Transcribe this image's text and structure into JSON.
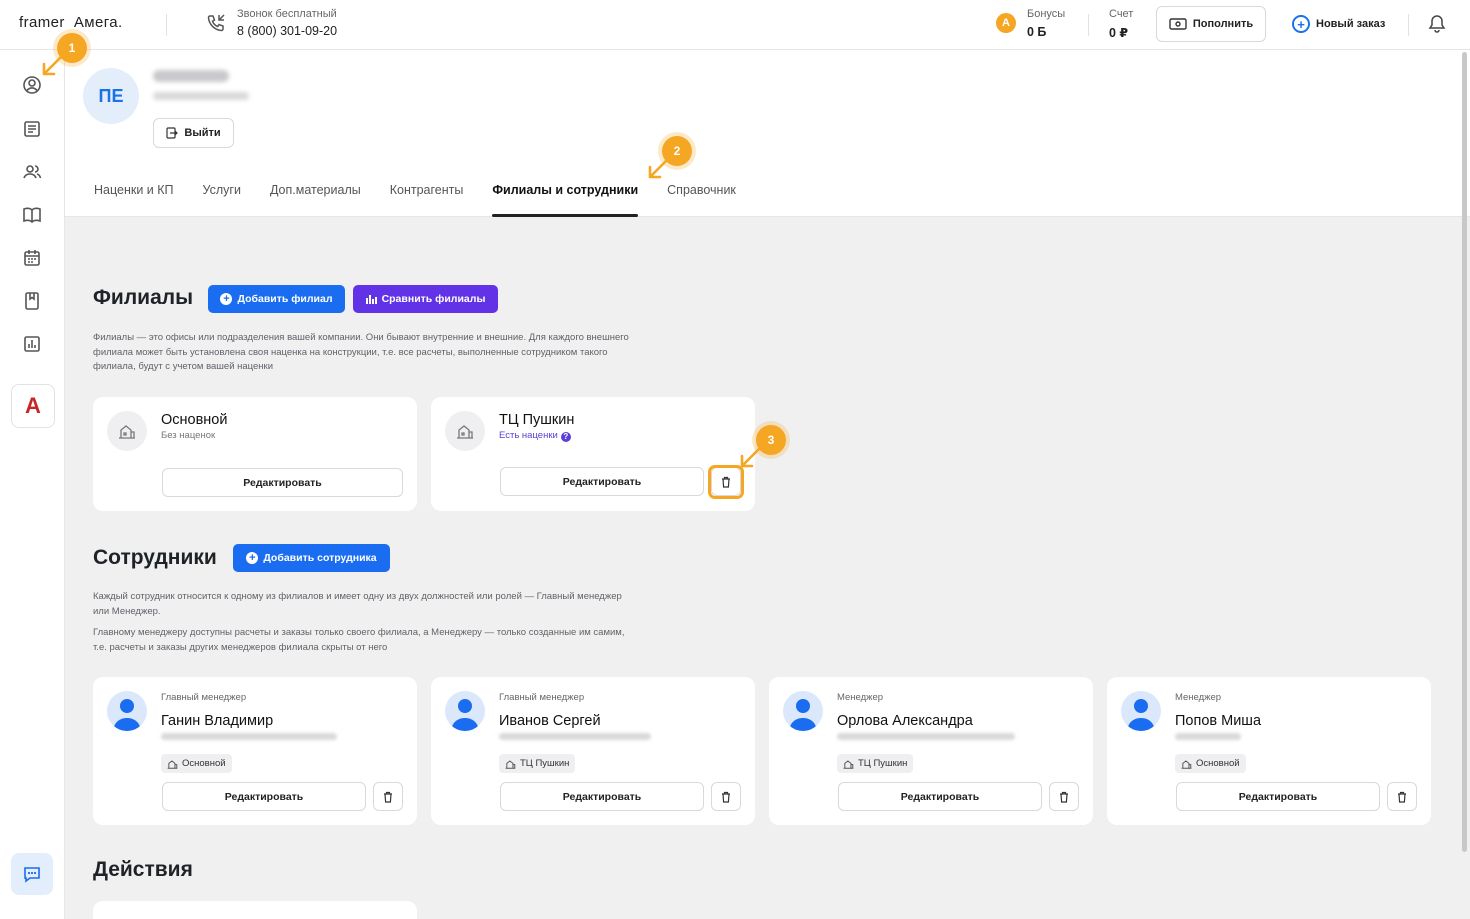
{
  "topbar": {
    "logo_left": "framer",
    "logo_right": "Амега.",
    "phone_caption": "Звонок бесплатный",
    "phone_number": "8 (800) 301-09-20",
    "bonus_caption": "Бонусы",
    "bonus_value": "0 Б",
    "account_caption": "Счет",
    "account_value": "0 ₽",
    "topup_label": "Пополнить",
    "new_order_label": "Новый заказ",
    "bonus_coin_letter": "A"
  },
  "sidebar": {
    "icons": [
      "profile-icon",
      "orders-icon",
      "users-icon",
      "catalog-book-icon",
      "calendar-icon",
      "bookmark-icon",
      "report-chart-icon"
    ],
    "brand_letter": "A",
    "chat_icon": "chat-icon"
  },
  "profile": {
    "avatar_initials": "ПЕ",
    "logout_label": "Выйти"
  },
  "tabs": [
    {
      "label": "Наценки и КП",
      "active": false
    },
    {
      "label": "Услуги",
      "active": false
    },
    {
      "label": "Доп.материалы",
      "active": false
    },
    {
      "label": "Контрагенты",
      "active": false
    },
    {
      "label": "Филиалы и сотрудники",
      "active": true
    },
    {
      "label": "Справочник",
      "active": false
    }
  ],
  "branches": {
    "title": "Филиалы",
    "add_label": "Добавить филиал",
    "compare_label": "Сравнить филиалы",
    "description": "Филиалы — это офисы или подразделения вашей компании. Они бывают внутренние и внешние. Для каждого внешнего филиала может быть установлена своя наценка на конструкции, т.е. все расчеты, выполненные сотрудником такого филиала, будут с учетом вашей наценки",
    "items": [
      {
        "name": "Основной",
        "subtitle": "Без наценок",
        "edit_label": "Редактировать"
      },
      {
        "name": "ТЦ Пушкин",
        "subtitle": "Есть наценки",
        "edit_label": "Редактировать"
      }
    ]
  },
  "employees": {
    "title": "Сотрудники",
    "add_label": "Добавить сотрудника",
    "description_1": "Каждый сотрудник относится к одному из филиалов и имеет одну из двух должностей или ролей — Главный менеджер или Менеджер.",
    "description_2": "Главному менеджеру доступны расчеты и заказы только своего филиала, а Менеджеру — только созданные им самим, т.е. расчеты и заказы других менеджеров филиала скрыты от него",
    "items": [
      {
        "role": "Главный менеджер",
        "name": "Ганин Владимир",
        "branch": "Основной",
        "edit_label": "Редактировать"
      },
      {
        "role": "Главный менеджер",
        "name": "Иванов Сергей",
        "branch": "ТЦ Пушкин",
        "edit_label": "Редактировать"
      },
      {
        "role": "Менеджер",
        "name": "Орлова Александра",
        "branch": "ТЦ Пушкин",
        "edit_label": "Редактировать"
      },
      {
        "role": "Менеджер",
        "name": "Попов Миша",
        "branch": "Основной",
        "edit_label": "Редактировать"
      }
    ]
  },
  "actions": {
    "title": "Действия"
  },
  "annotations": {
    "badge_1": "1",
    "badge_2": "2",
    "badge_3": "3",
    "accent_color": "#f5a623"
  }
}
